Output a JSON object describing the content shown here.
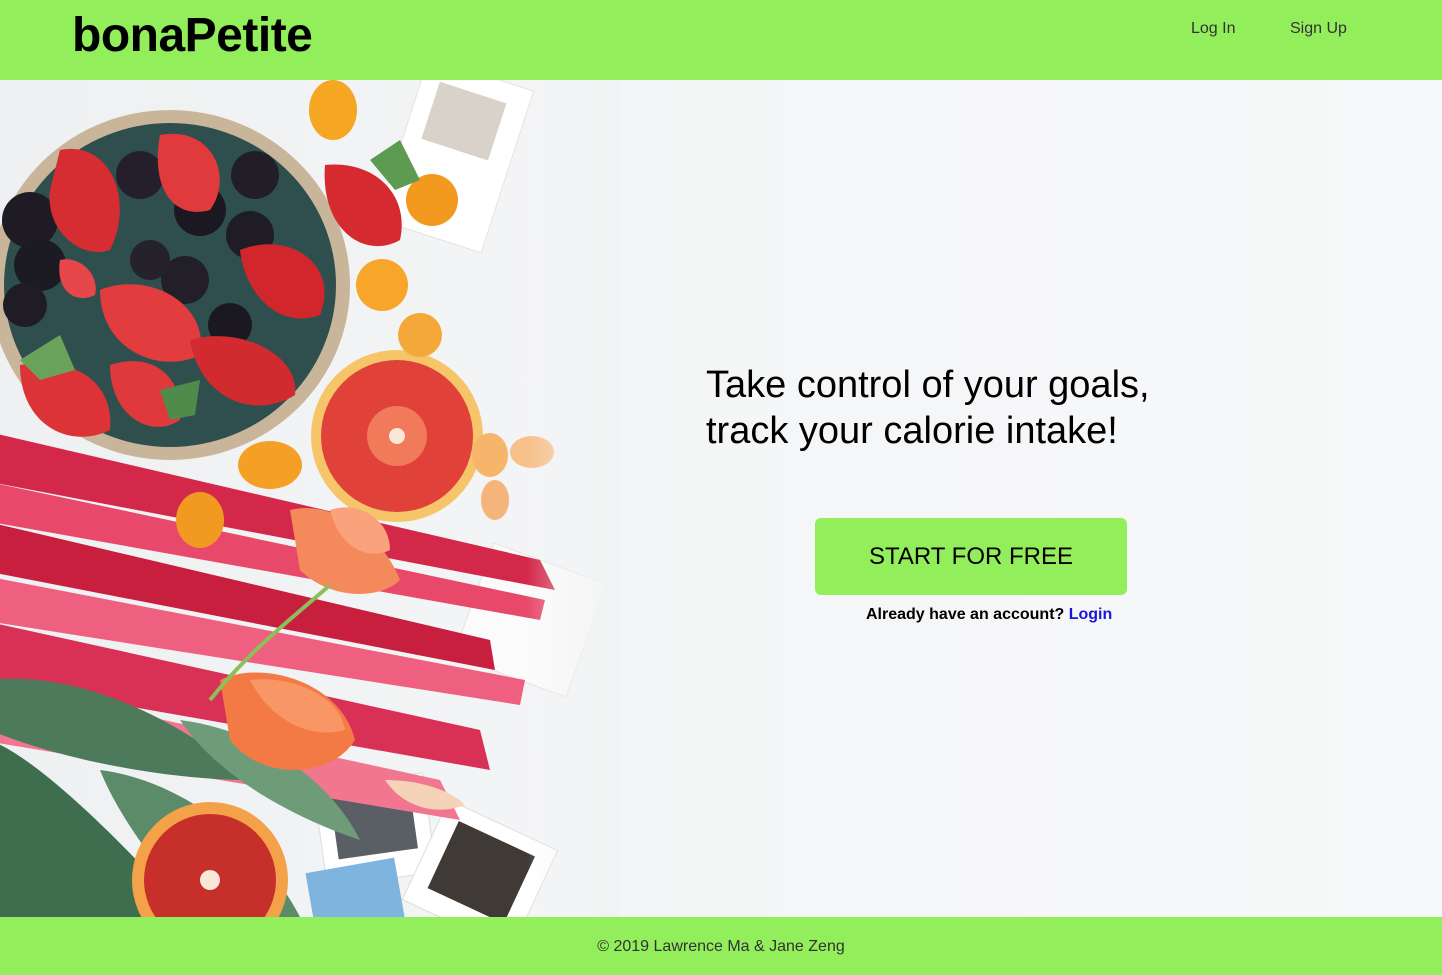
{
  "header": {
    "logo": "bonaPetite",
    "nav": {
      "login": "Log In",
      "signup": "Sign Up"
    },
    "color": "#93ee5c"
  },
  "hero": {
    "headline_line1": "Take control of your goals,",
    "headline_line2": "track your calorie intake!",
    "cta_label": "START FOR FREE",
    "account_prompt": "Already have an account?",
    "account_link": "Login",
    "link_color": "#1a15d8"
  },
  "footer": {
    "copyright": "© 2019 Lawrence Ma & Jane Zeng"
  }
}
